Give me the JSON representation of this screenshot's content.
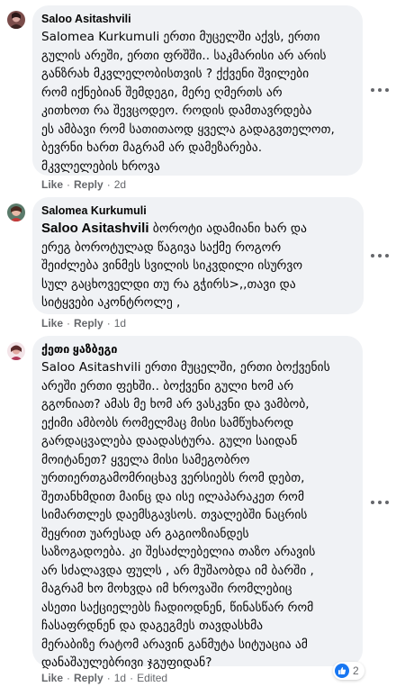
{
  "comments": [
    {
      "author": "Saloo Asitashvili",
      "text": "Salomea Kurkumuli ერთი მუცელში აქვს, ერთი\nგულის არეში, ერთი ფრშში.. საკმარისი არ არის\nგანზრახ მკვლელობისთვის ? ქქვენი შვილები\nრომ იქნებიან შემდეგი, მერე ღმერთს არ\nკითხოთ რა შევცოდეო. როდის დამთავრდება\nეს ამბავი რომ სათითაოდ ყველა გადაგვთელოთ,\nბევრნი ხართ მაგრამ არ დამეზარება.\nმკვლელების ხროვა",
      "like_label": "Like",
      "reply_label": "Reply",
      "time": "2d"
    },
    {
      "author": "Salomea Kurkumuli",
      "mention": "Saloo Asitashvili",
      "text": " ბოროტი ადამიანი ხარ და\nერეგ ბოროტულად წაგივა საქმე როგორ\nშეიძლება ვინმეს სვილის სიკვდილი ისურვო\nსულ გაცხოველდი თუ რა გჭირს>,,თავი და\nსიტყვები აკონტროლე ,",
      "like_label": "Like",
      "reply_label": "Reply",
      "time": "1d"
    },
    {
      "author": "ქეთი ყაზბეგი",
      "text": "Saloo Asitashvili ერთი მუცელში, ერთი ბოქვენის\nარეში ერთი ფეხში.. ბოქვენი გული ხომ არ\nგგონიათ? ამას მე ხომ არ ვასკვნი და ვამბობ,\nექიმი ამბობს რომელმაც მისი სამწუხაროდ\nგარდაცვალება დაადასტურა. გული საიდან\nმოიტანეთ? ყველა მისი სამეგობრო\nურთიერთგამომრიცხავ ვერსიებს რომ დებთ,\nშეთანხმდით მაინც და ისე ილაპარაკეთ რომ\nსიმართლეს დაემსგავსოს. თვალებში ნაცრის\nშეყრით უარესად არ გაგიოზიანდეს\nსაზოგადოება. კი შესაძლებელია თაზო არავის\nარ სძალავდა ფულს , არ მუშაობდა იმ ბარში ,\nმაგრამ ხო მოხვდა იმ ხროვაში რომლებიც\nასეთი საქციელებს ჩადიოდნენ, წინასწარ რომ\nჩასაფრდნენ და დაგეგმეს თავდასხმა\nმერაბიზე რატომ არავინ განმუტა სიტუაცია ამ\nდანაშაულებრივი ჯგუფიდან?",
      "like_label": "Like",
      "reply_label": "Reply",
      "time": "1d",
      "edited_label": "Edited",
      "reaction_count": "2"
    }
  ],
  "colors": {
    "bubble": "#f0f2f5",
    "meta_text": "#65676b",
    "like_blue": "#1877f2"
  },
  "icons": {
    "more_options": "more-options-icon",
    "like_reaction": "like-reaction-icon"
  }
}
